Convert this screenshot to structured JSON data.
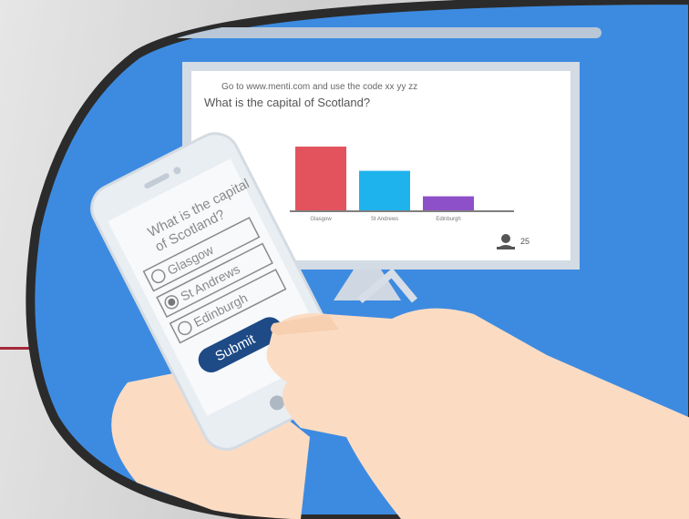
{
  "presentation_screen": {
    "instruction": "Go to www.menti.com and use the code xx yy zz",
    "question": "What is the capital of Scotland?",
    "participant_count": "25"
  },
  "chart_data": {
    "type": "bar",
    "categories": [
      "Glasgow",
      "St Andrews",
      "Edinburgh"
    ],
    "values": [
      100,
      62,
      22
    ],
    "colors": [
      "#e2535e",
      "#1fb3ee",
      "#8e50c8"
    ],
    "title": "",
    "xlabel": "",
    "ylabel": ""
  },
  "phone": {
    "question": "What is the capital of Scotland?",
    "options": [
      {
        "label": "Glasgow",
        "selected": false
      },
      {
        "label": "St Andrews",
        "selected": true
      },
      {
        "label": "Edinburgh",
        "selected": false
      }
    ],
    "submit_label": "Submit"
  },
  "colors": {
    "background_blue": "#3d8be0",
    "frame_dark": "#2b2b2b",
    "slide_accent": "#a6283a",
    "submit_button": "#1e4a86",
    "skin": "#fbdcc3"
  },
  "icons": [
    "person-icon"
  ]
}
